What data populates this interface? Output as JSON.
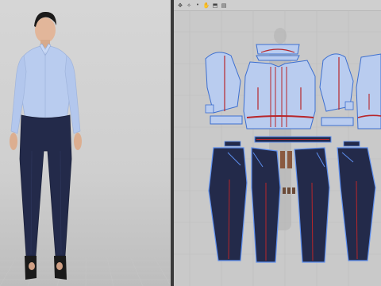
{
  "app": {
    "panels": [
      "3d-view",
      "2d-pattern-view"
    ]
  },
  "toolbar": {
    "tools": [
      {
        "name": "transform-icon",
        "glyph": "✥"
      },
      {
        "name": "select-icon",
        "glyph": "✧"
      },
      {
        "name": "point-icon",
        "glyph": "•"
      },
      {
        "name": "hand-icon",
        "glyph": "✋"
      },
      {
        "name": "fold-icon",
        "glyph": "⬒"
      },
      {
        "name": "print-icon",
        "glyph": "▤"
      }
    ]
  },
  "colors": {
    "shirt": "#b9ccef",
    "shirt_outline": "#3d6fd0",
    "pants": "#232a4a",
    "pants_outline": "#5d8ff0",
    "seam_red": "#b8262a",
    "grid": "#bdbdbd",
    "bg_2d": "#c9c9c9",
    "bg_3d": "#d2d2d2"
  }
}
